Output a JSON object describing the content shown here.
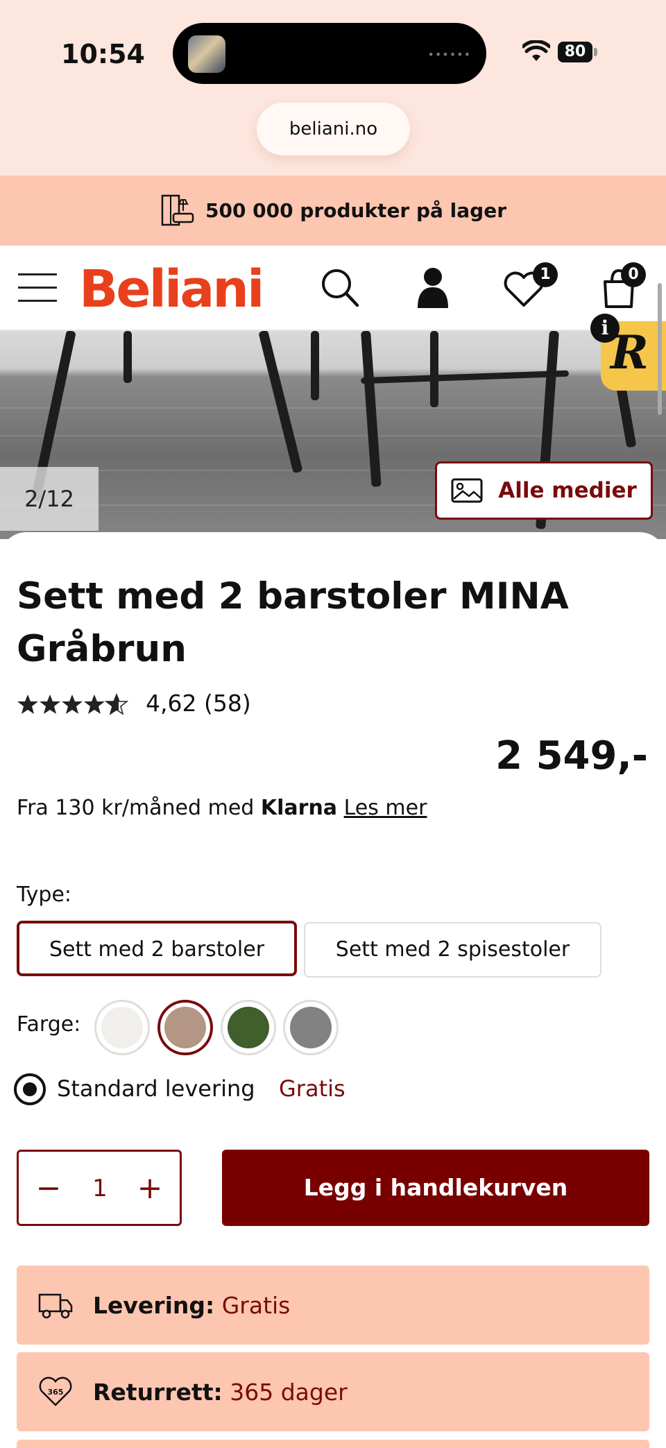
{
  "status_bar": {
    "time": "10:54",
    "battery": "80"
  },
  "browser": {
    "url": "beliani.no"
  },
  "promo": {
    "text": "500 000 produkter på lager"
  },
  "header": {
    "logo": "Beliani",
    "wishlist_count": "1",
    "cart_count": "0"
  },
  "gallery": {
    "current": "2",
    "separator": "/",
    "total": "12",
    "all_media_label": "Alle medier"
  },
  "product": {
    "title": "Sett med 2 barstoler MINA Gråbrun",
    "rating_value": 4.62,
    "rating_text": "4,62 (58)",
    "price": "2 549,-",
    "klarna_prefix": "Fra 130 kr/måned med",
    "klarna_brand": "Klarna",
    "klarna_link": "Les mer"
  },
  "options": {
    "type_label": "Type:",
    "types": [
      "Sett med 2 barstoler",
      "Sett med 2 spisestoler"
    ],
    "selected_type": "Sett med 2 barstoler",
    "color_label": "Farge:",
    "colors": [
      "#f1efeb",
      "#b39684",
      "#3f5f2c",
      "#828282"
    ],
    "selected_color_index": 1
  },
  "delivery": {
    "label": "Standard levering",
    "price": "Gratis"
  },
  "cart": {
    "quantity": "1",
    "minus": "−",
    "plus": "+",
    "add_label": "Legg i handlekurven"
  },
  "info": {
    "delivery_label": "Levering:",
    "delivery_value": "Gratis",
    "returns_label": "Returrett:",
    "returns_value": "365 dager"
  },
  "colors": {
    "accent": "#780000",
    "brand": "#e8401c",
    "peach": "#fdc6b0"
  }
}
